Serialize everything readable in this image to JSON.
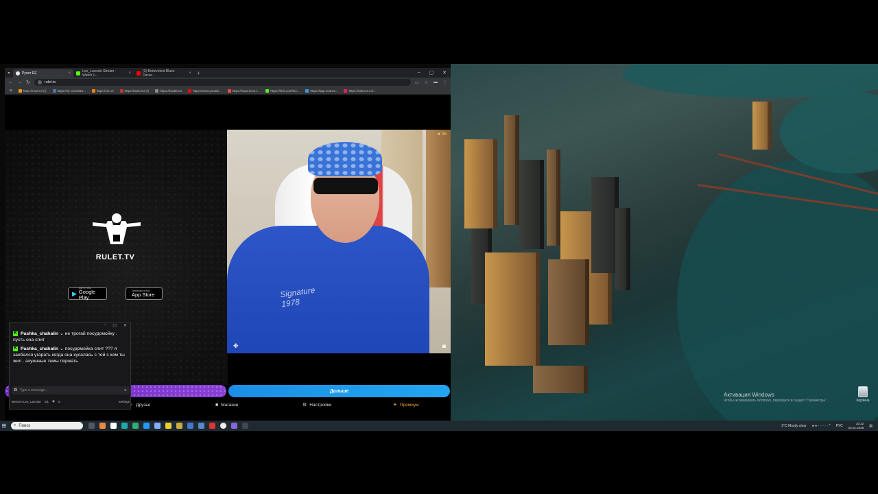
{
  "browser": {
    "tabs": [
      {
        "label": "Рулет ЕЕ",
        "icon": "chrome-icon",
        "active": true
      },
      {
        "label": "Leo_Lacoste Stream - Watch Li...",
        "icon": "kick-icon",
        "active": false
      },
      {
        "label": "(3) Benevolent Blues - Oscar...",
        "icon": "youtube-icon",
        "active": false
      }
    ],
    "window_controls": [
      "–",
      "▢",
      "✕"
    ],
    "url": "rulet.tv",
    "bookmarks": [
      "https://mail.ru/ (!)",
      "https://vk.com/id19...",
      "https://ok.ru/",
      "https://tanki.su/ (!)",
      "https://lostbit.ru/",
      "https://www.youtub...",
      "https://www.lcmu.l...",
      "https://kick.com/leo...",
      "https://app.restrea...",
      "https://2dtrnsz.ml/..."
    ]
  },
  "site": {
    "logo_text": "RULET.TV",
    "google_play": {
      "small": "GET IT ON",
      "big": "Google Play"
    },
    "app_store": {
      "small": "Download on the",
      "big": "App Store"
    },
    "rating": "★ 25",
    "next_button": "Дальше",
    "nav": {
      "friends": "Друзья",
      "shop": "Магазин",
      "settings": "Настройки",
      "premium": "Премиум"
    }
  },
  "chat": {
    "messages": [
      {
        "user": "Pashka_chahalin",
        "text": "не трогай посудомойку . пусть она спит"
      },
      {
        "user": "Pashka_chahalin",
        "text": "посудомойка спит ??? я заебался угарать когда она кусалась с той с кем ты жил . ахуенные темы поржать"
      }
    ],
    "input_placeholder": "Type a message...",
    "footer": {
      "channel": "Benorm Leo_Lacoste",
      "count1": "1/1",
      "count2": "5",
      "extra": "Settings"
    }
  },
  "desktop": {
    "watermark_title": "Активация Windows",
    "watermark_sub": "Чтобы активировать Windows, перейдите в раздел \"Параметры\".",
    "recycle_label": "Корзина"
  },
  "taskbar": {
    "search_placeholder": "Поиск",
    "weather": "2°C  Mostly clear",
    "lang": "РУС",
    "time": "20:32",
    "date": "02.01.2026"
  },
  "colors": {
    "accent_blue": "#1a8fe6",
    "accent_purple": "#7a35c9",
    "kick_green": "#53fc18",
    "premium_orange": "#f0a030"
  }
}
